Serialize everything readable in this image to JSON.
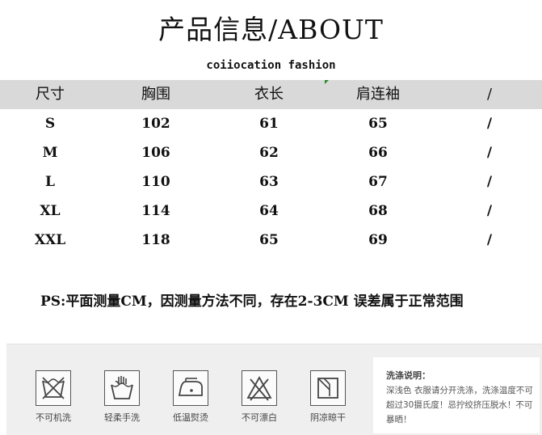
{
  "title": "产品信息/ABOUT",
  "subtitle": "coiiocation fashion",
  "table": {
    "headers": [
      "尺寸",
      "胸围",
      "衣长",
      "肩连袖",
      "/"
    ],
    "rows": [
      [
        "S",
        "102",
        "61",
        "65",
        "/"
      ],
      [
        "M",
        "106",
        "62",
        "66",
        "/"
      ],
      [
        "L",
        "110",
        "63",
        "67",
        "/"
      ],
      [
        "XL",
        "114",
        "64",
        "68",
        "/"
      ],
      [
        "XXL",
        "118",
        "65",
        "69",
        "/"
      ]
    ]
  },
  "note": "PS:平面测量CM，因测量方法不同，存在2-3CM 误差属于正常范围",
  "care": {
    "icons": [
      {
        "label": "不可机洗",
        "icon": "no-machine-wash-icon"
      },
      {
        "label": "轻柔手洗",
        "icon": "hand-wash-icon"
      },
      {
        "label": "低温熨烫",
        "icon": "low-iron-icon"
      },
      {
        "label": "不可漂白",
        "icon": "no-bleach-icon"
      },
      {
        "label": "阴凉晾干",
        "icon": "shade-dry-icon"
      }
    ],
    "instructions_title": "洗涤说明：",
    "instructions_text": "深浅色 衣服请分开洗涤，洗涤温度不可超过30摄氏度！忌拧绞挤压脱水！不可暴晒！"
  }
}
